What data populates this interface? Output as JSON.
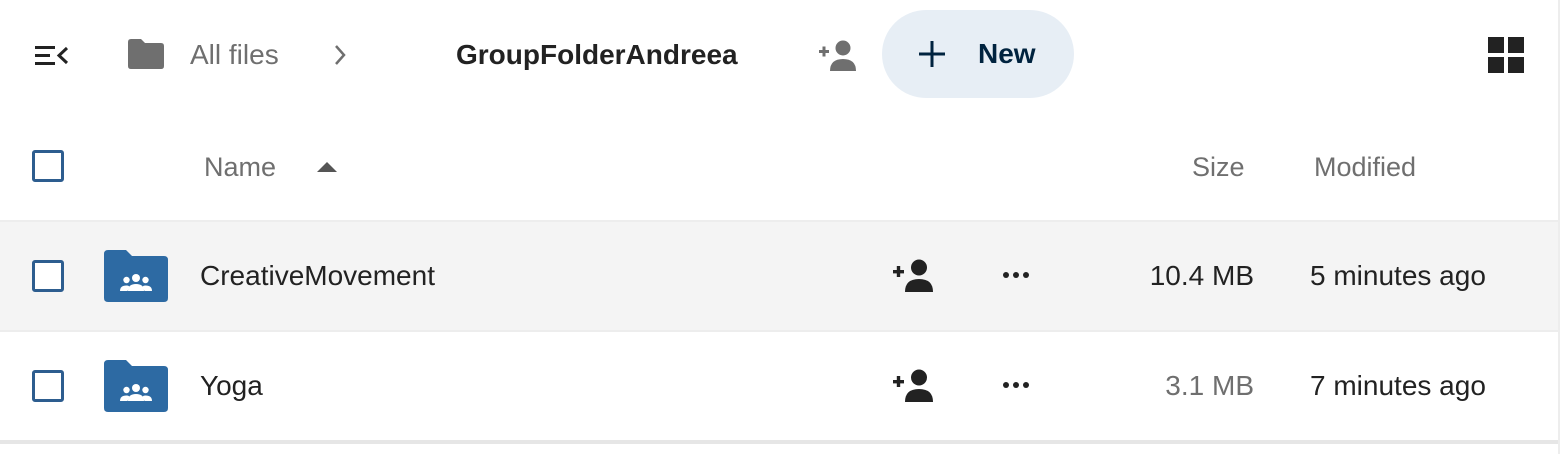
{
  "header": {
    "breadcrumb_root": "All files",
    "breadcrumb_current": "GroupFolderAndreea",
    "new_button_label": "New"
  },
  "table": {
    "columns": {
      "name": "Name",
      "size": "Size",
      "modified": "Modified"
    },
    "sort": "ascending",
    "rows": [
      {
        "name": "CreativeMovement",
        "size": "10.4 MB",
        "modified": "5 minutes ago",
        "size_color": "#222222",
        "hovered": true
      },
      {
        "name": "Yoga",
        "size": "3.1 MB",
        "modified": "7 minutes ago",
        "size_color": "#6f6f6f",
        "hovered": false
      }
    ]
  },
  "colors": {
    "accent": "#2d5d8f",
    "folder": "#2d6aa3",
    "new_button_bg": "#e7eef5",
    "new_button_text": "#00233f"
  },
  "icons": {
    "sidebar_toggle": "menu-collapse-icon",
    "breadcrumb_folder": "folder-icon",
    "breadcrumb_separator": "chevron-right-icon",
    "share": "account-plus-icon",
    "new": "plus-icon",
    "view_toggle": "grid-view-icon",
    "sort": "triangle-up-icon",
    "row_folder": "group-folder-icon",
    "row_actions": "more-horizontal-icon"
  }
}
